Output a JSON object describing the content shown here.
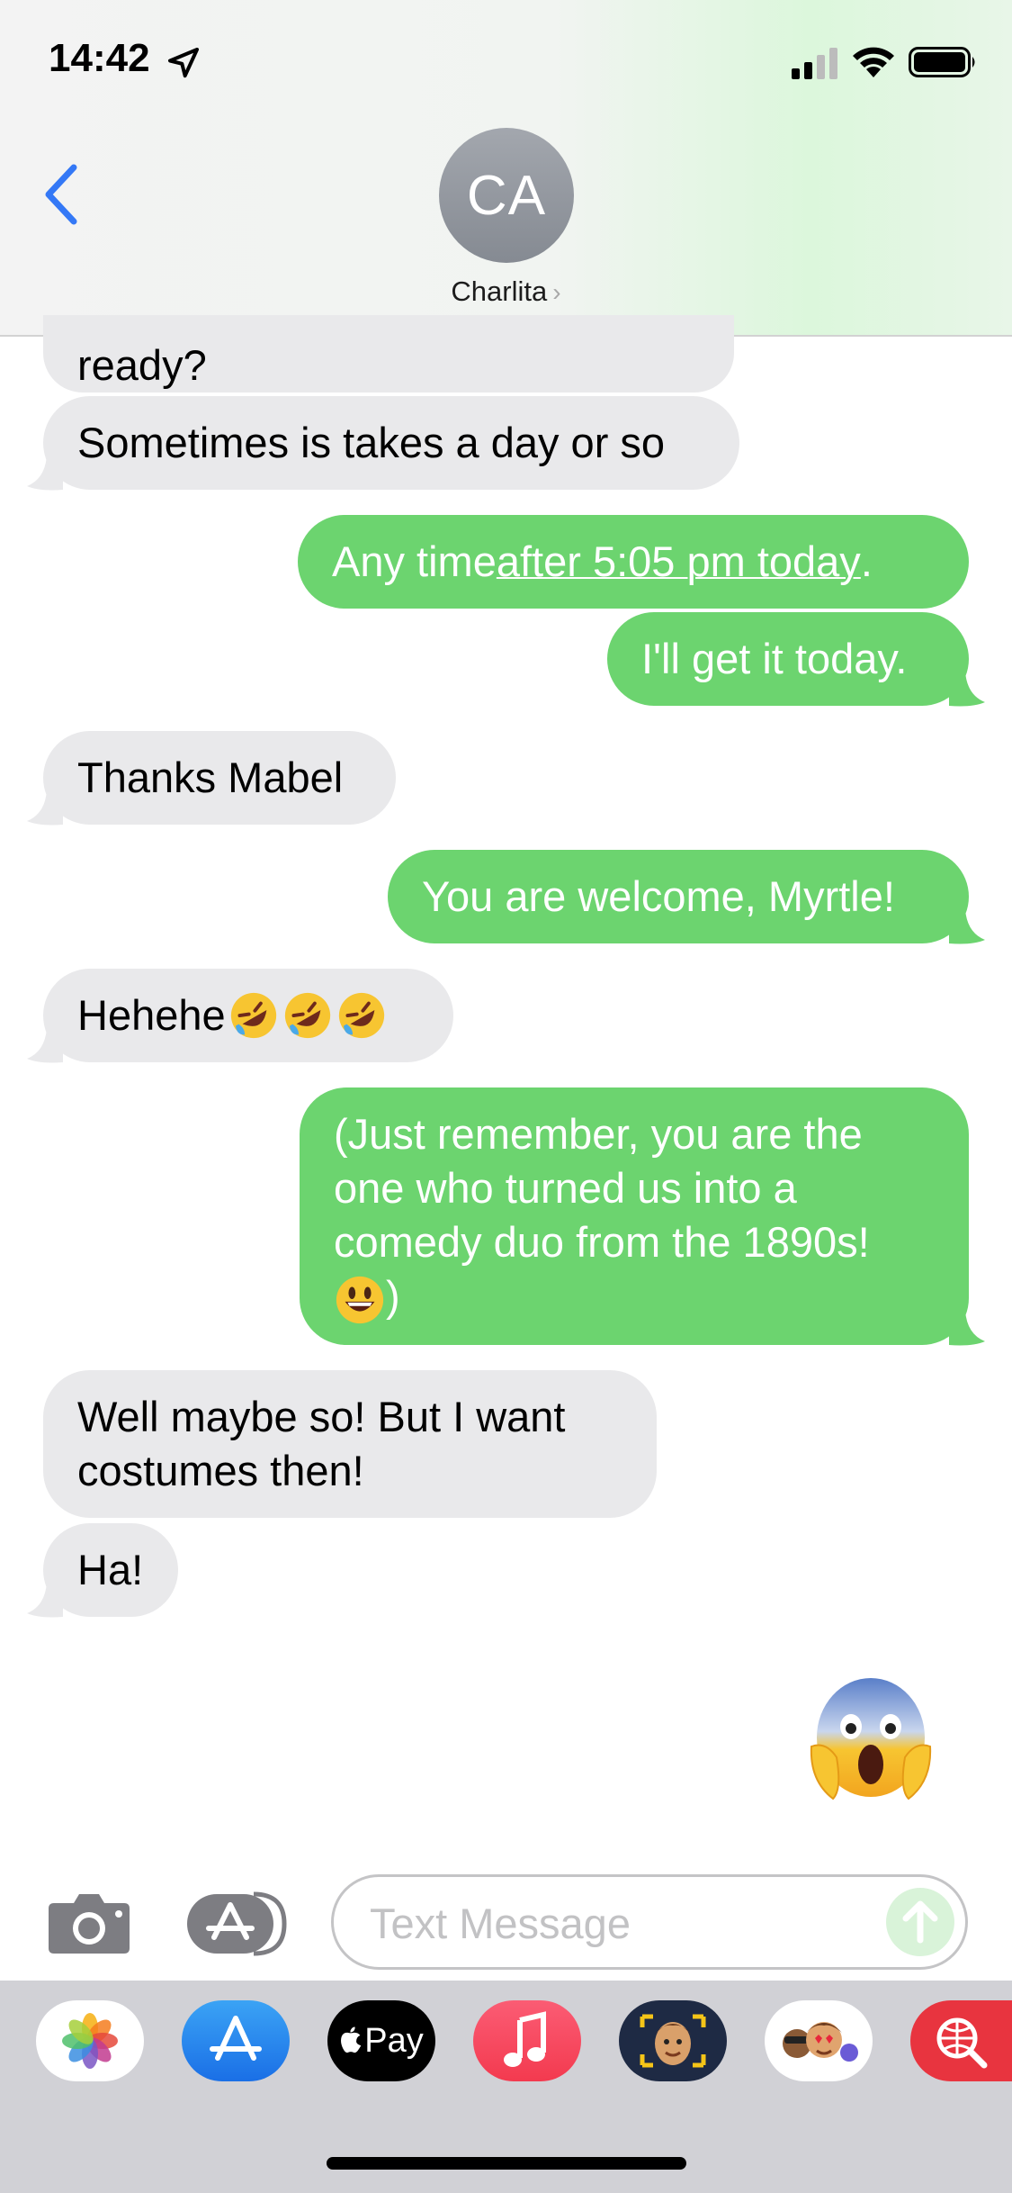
{
  "status": {
    "time": "14:42"
  },
  "header": {
    "avatar_initials": "CA",
    "contact_name": "Charlita"
  },
  "messages": [
    {
      "dir": "in",
      "text": "ready?"
    },
    {
      "dir": "in",
      "text": "Sometimes is takes a day or so"
    },
    {
      "dir": "out",
      "text_before": "Any time ",
      "link": "after 5:05 pm today",
      "text_after": "."
    },
    {
      "dir": "out",
      "text": "I'll get it today."
    },
    {
      "dir": "in",
      "text": "Thanks Mabel"
    },
    {
      "dir": "out",
      "text": "You are welcome, Myrtle!"
    },
    {
      "dir": "in",
      "text": "Hehehe",
      "emoji": [
        "rolling-on-floor-laughing",
        "rolling-on-floor-laughing",
        "rolling-on-floor-laughing"
      ]
    },
    {
      "dir": "out",
      "lines": [
        "(Just remember, you are the",
        "one who turned us into a",
        "comedy duo from the 1890s!"
      ],
      "last_line_suffix": ")",
      "emoji": "smiling-face"
    },
    {
      "dir": "in",
      "lines": [
        "Well maybe so!  But I want",
        "costumes then!"
      ]
    },
    {
      "dir": "in",
      "text": "Ha!"
    },
    {
      "dir": "out",
      "emoji": "face-screaming-in-fear"
    }
  ],
  "composer": {
    "placeholder": "Text Message"
  },
  "apps": [
    {
      "name": "photos"
    },
    {
      "name": "app-store"
    },
    {
      "name": "apple-pay",
      "label": "Pay"
    },
    {
      "name": "music"
    },
    {
      "name": "memoji"
    },
    {
      "name": "memoji-stickers"
    },
    {
      "name": "web-images-search"
    }
  ],
  "colors": {
    "outgoing": "#6cd46f",
    "incoming": "#e9e9eb",
    "accent": "#3478f6"
  }
}
